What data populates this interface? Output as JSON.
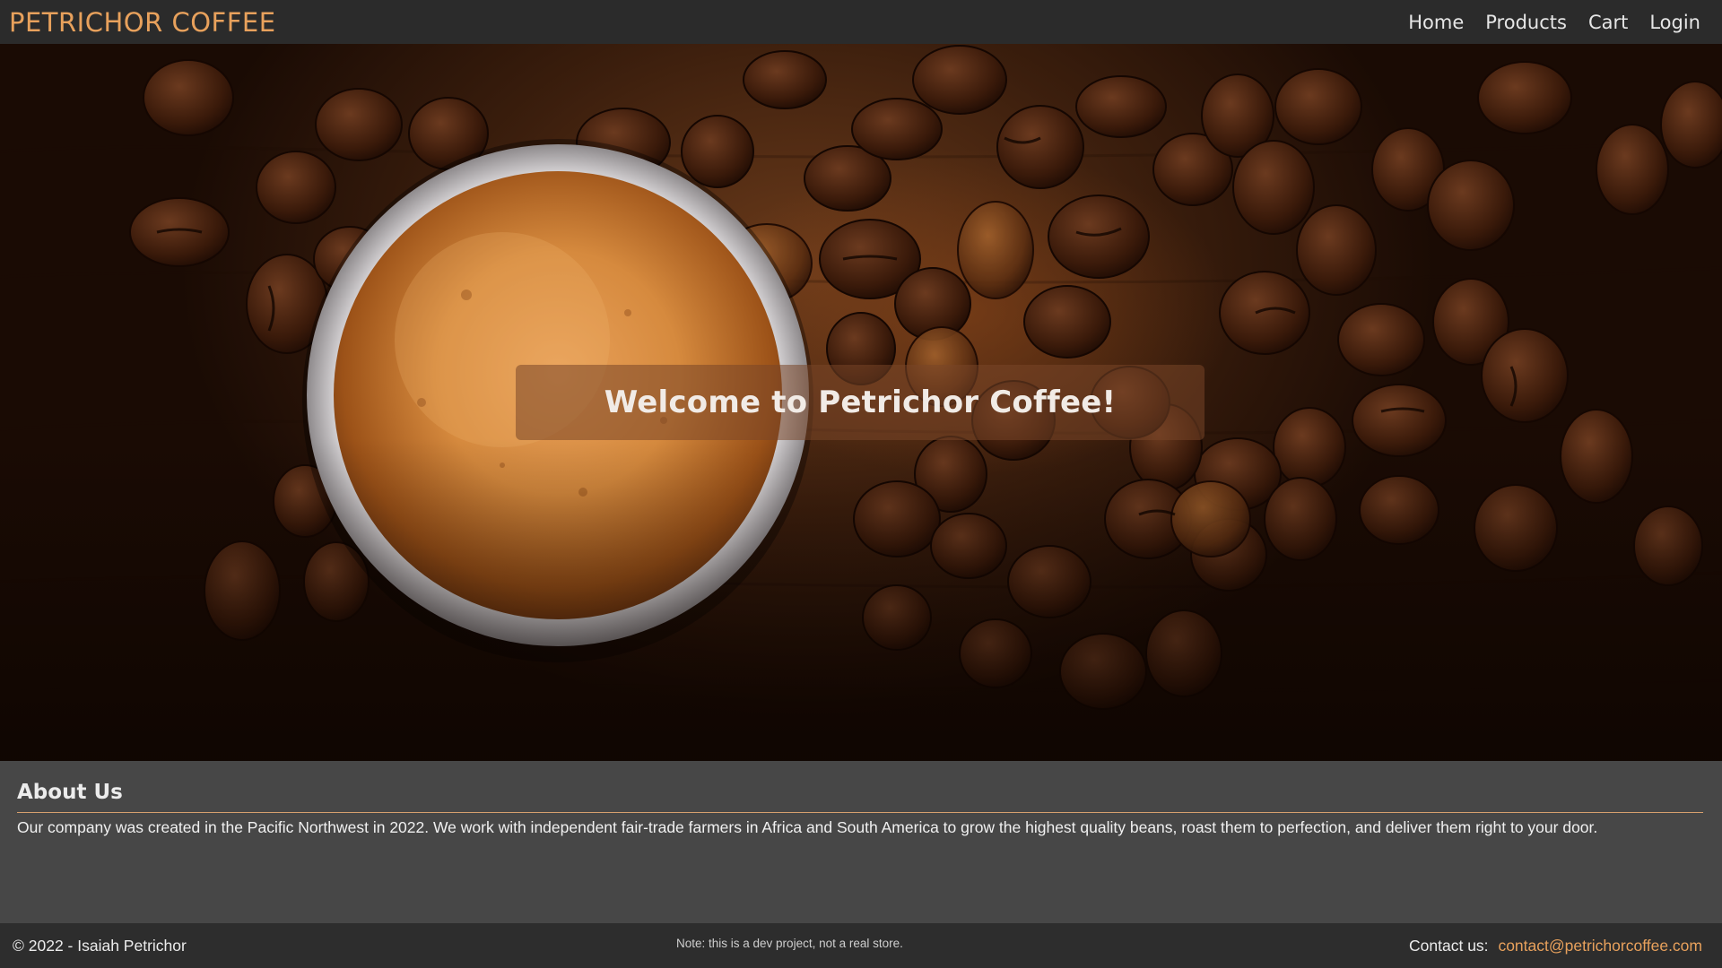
{
  "header": {
    "brand": "PETRICHOR COFFEE",
    "nav": [
      "Home",
      "Products",
      "Cart",
      "Login"
    ]
  },
  "hero": {
    "welcome": "Welcome to Petrichor Coffee!",
    "image_subject": "coffee-cup-and-beans-photo"
  },
  "about": {
    "title": "About Us",
    "text": "Our company was created in the Pacific Northwest in 2022. We work with independent fair-trade farmers in Africa and South America to grow the highest quality beans, roast them to perfection, and deliver them right to your door."
  },
  "footer": {
    "copyright": "© 2022 - Isaiah Petrichor",
    "note": "Note: this is a dev project, not a real store.",
    "contact_label": "Contact us:",
    "contact_email": "contact@petrichorcoffee.com"
  },
  "colors": {
    "accent": "#e8a15c",
    "header_bg": "#2b2b2b",
    "body_bg": "#474747",
    "footer_bg": "#2d2d2d"
  }
}
